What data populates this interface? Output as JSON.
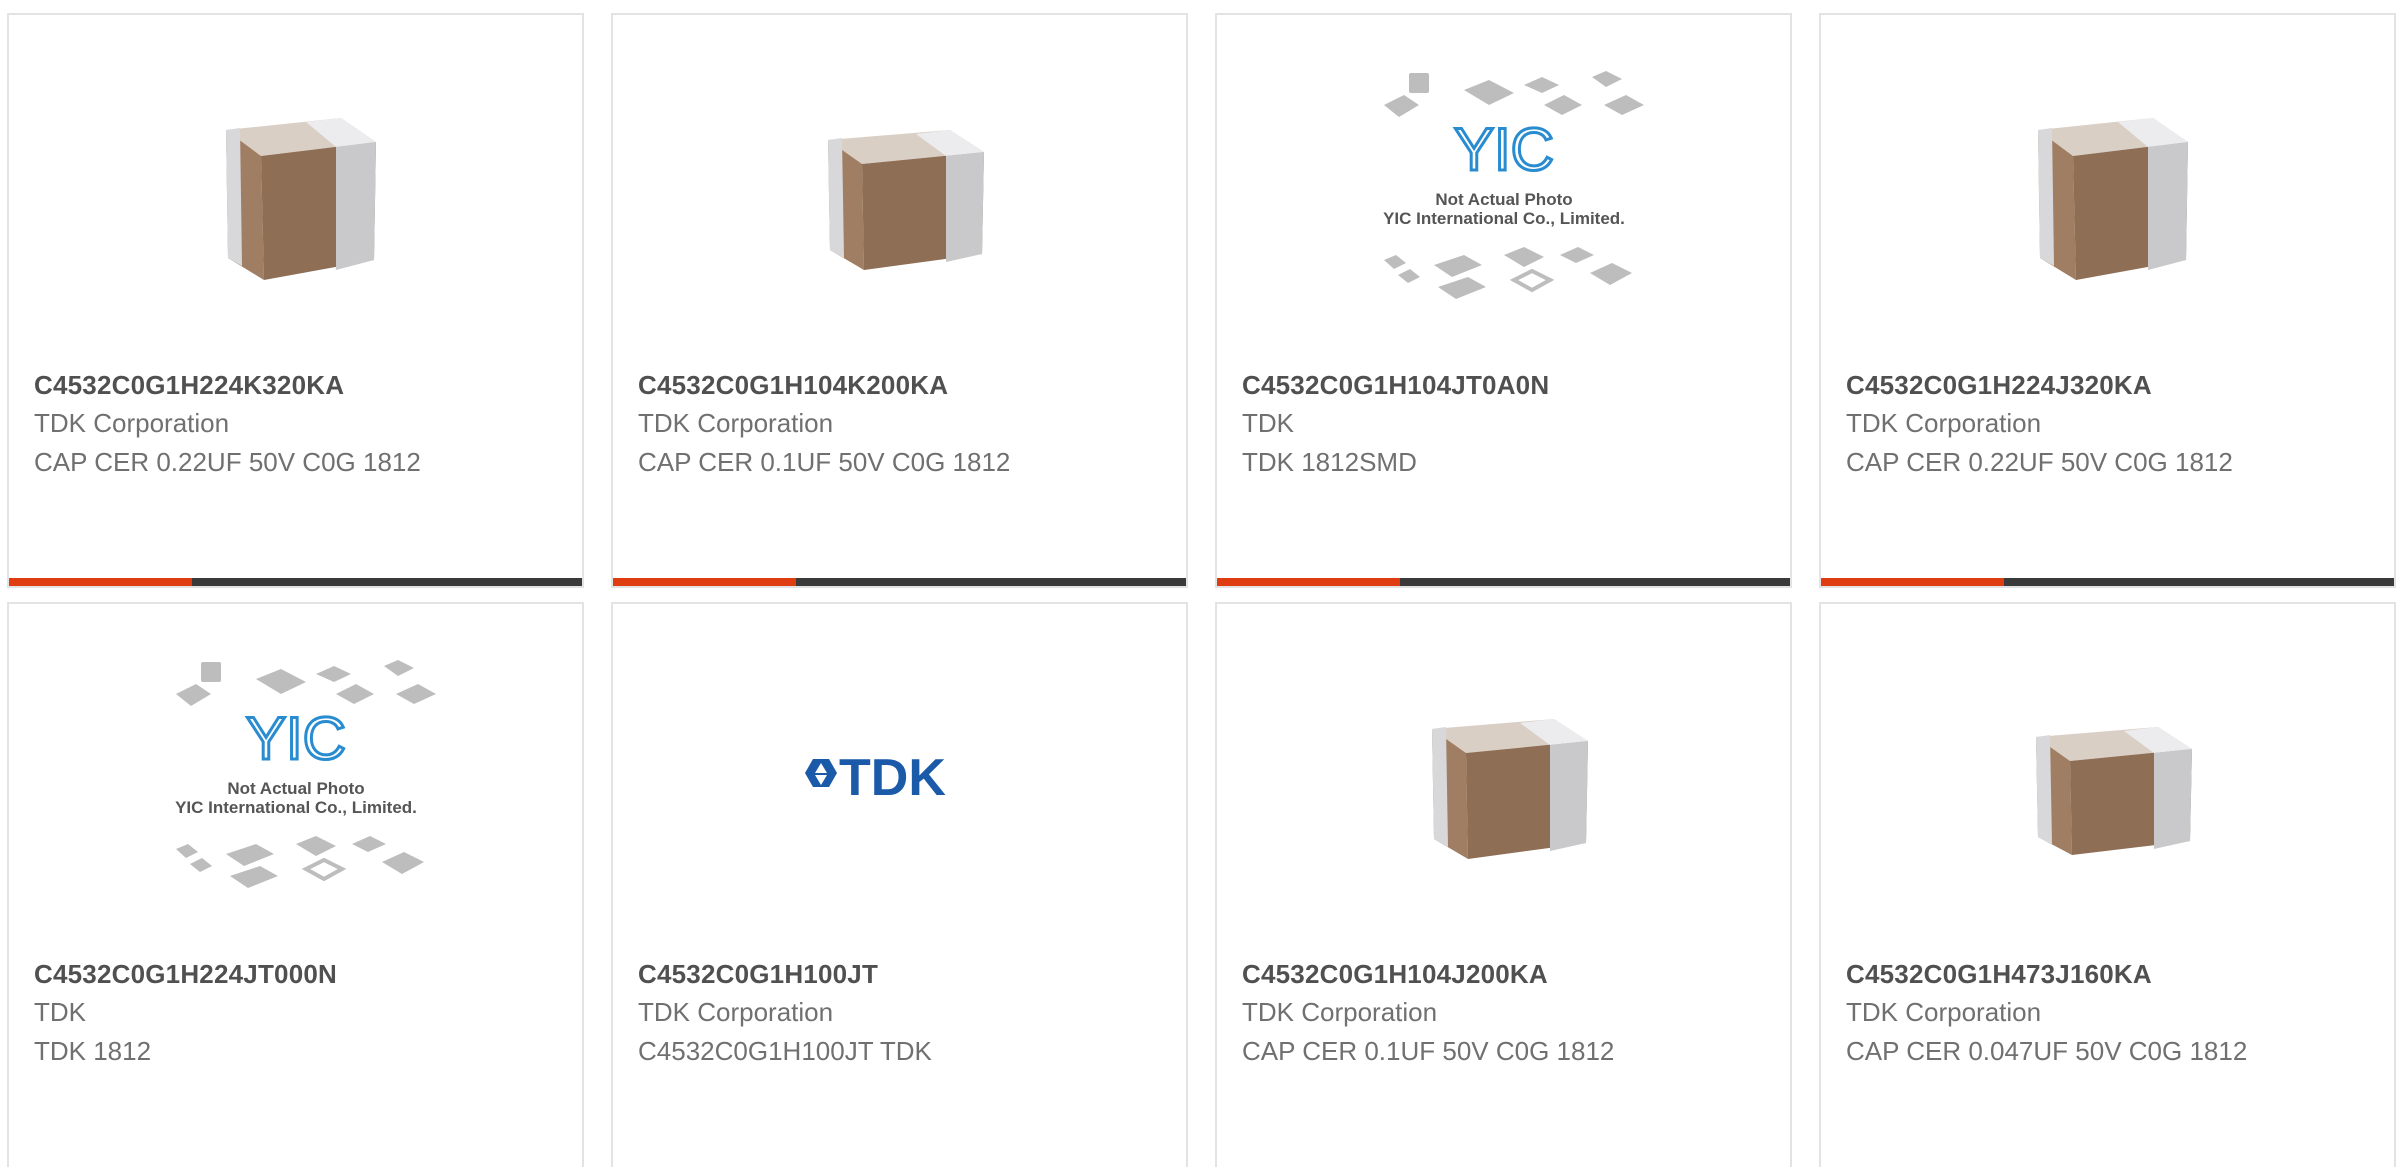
{
  "colors": {
    "accent": "#e03c12",
    "bar_dark": "#3a3a3a",
    "card_border": "#e3e3e3",
    "part_text": "#505050",
    "meta_text": "#707070",
    "tdk_blue": "#1a5aa8",
    "yic_blue": "#2a8cd0"
  },
  "products": [
    {
      "image": "capacitor-chip-icon",
      "part_number": "C4532C0G1H224K320KA",
      "manufacturer": "TDK Corporation",
      "description": "CAP CER 0.22UF 50V C0G 1812"
    },
    {
      "image": "capacitor-chip-icon",
      "part_number": "C4532C0G1H104K200KA",
      "manufacturer": "TDK Corporation",
      "description": "CAP CER 0.1UF 50V C0G 1812"
    },
    {
      "image": "yic-placeholder-icon",
      "part_number": "C4532C0G1H104JT0A0N",
      "manufacturer": "TDK",
      "description": "TDK 1812SMD",
      "placeholder_line1": "Not Actual Photo",
      "placeholder_line2": "YIC International Co., Limited.",
      "logo_text": "YIC"
    },
    {
      "image": "capacitor-chip-icon",
      "part_number": "C4532C0G1H224J320KA",
      "manufacturer": "TDK Corporation",
      "description": "CAP CER 0.22UF 50V C0G 1812"
    },
    {
      "image": "yic-placeholder-icon",
      "part_number": "C4532C0G1H224JT000N",
      "manufacturer": "TDK",
      "description": "TDK 1812",
      "placeholder_line1": "Not Actual Photo",
      "placeholder_line2": "YIC International Co., Limited.",
      "logo_text": "YIC"
    },
    {
      "image": "tdk-logo-icon",
      "part_number": "C4532C0G1H100JT",
      "manufacturer": "TDK Corporation",
      "description": "C4532C0G1H100JT TDK",
      "logo_text": "TDK"
    },
    {
      "image": "capacitor-chip-icon",
      "part_number": "C4532C0G1H104J200KA",
      "manufacturer": "TDK Corporation",
      "description": "CAP CER 0.1UF 50V C0G 1812"
    },
    {
      "image": "capacitor-chip-icon",
      "part_number": "C4532C0G1H473J160KA",
      "manufacturer": "TDK Corporation",
      "description": "CAP CER 0.047UF 50V C0G 1812"
    }
  ]
}
